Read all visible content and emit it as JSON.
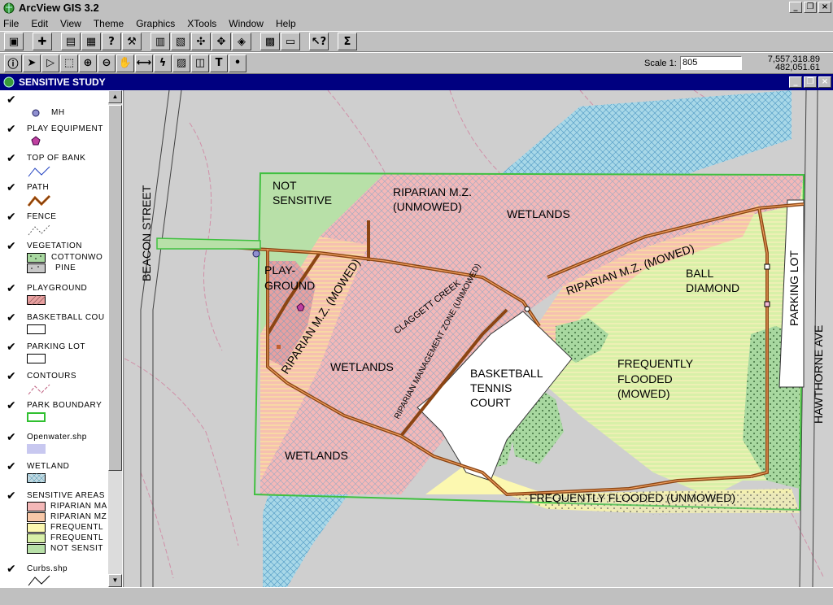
{
  "app": {
    "title": "ArcView GIS 3.2"
  },
  "menu": [
    "File",
    "Edit",
    "View",
    "Theme",
    "Graphics",
    "XTools",
    "Window",
    "Help"
  ],
  "toolbar": {
    "scale_label": "Scale 1:",
    "scale_value": "805",
    "coord_x": "7,557,318.89",
    "coord_y": "482,051.61"
  },
  "view": {
    "title": "SENSITIVE STUDY"
  },
  "legend": {
    "mh": "MH",
    "play_equipment": "PLAY EQUIPMENT",
    "top_of_bank": "TOP OF BANK",
    "path": "PATH",
    "fence": "FENCE",
    "vegetation": "VEGETATION",
    "cottonwood": "COTTONWO",
    "pine": "PINE",
    "playground": "PLAYGROUND",
    "basketball": "BASKETBALL COU",
    "parking_lot": "PARKING LOT",
    "contours": "CONTOURS",
    "park_boundary": "PARK BOUNDARY",
    "openwater": "Openwater.shp",
    "wetland": "WETLAND",
    "sensitive_areas": "SENSITIVE AREAS",
    "sa_items": [
      "RIPARIAN MA",
      "RIPARIAN MZ",
      "FREQUENTL",
      "FREQUENTL",
      "NOT SENSIT"
    ],
    "curbs": "Curbs.shp"
  },
  "colors": {
    "pink": "#f4b8b8",
    "peach": "#f8c8a8",
    "yellow": "#fcf8b0",
    "lightgreen": "#d8f0a8",
    "green": "#b8e0a8",
    "water": "#a8c8e8",
    "path": "#8b4513",
    "boundary": "#40c040",
    "titlebar": "#000080"
  },
  "map_labels": {
    "not_sensitive": [
      "NOT",
      "SENSITIVE"
    ],
    "riparian_unmowed": [
      "RIPARIAN M.Z.",
      "(UNMOWED)"
    ],
    "wetlands_top": "WETLANDS",
    "riparian_mowed_right": "RIPARIAN M.Z.  (MOWED)",
    "ball_diamond": [
      "BALL",
      "DIAMOND"
    ],
    "play_ground": [
      "PLAY-",
      "GROUND"
    ],
    "riparian_mowed_left": "RIPARIAN M.Z. (MOWED)",
    "claggett": "CLAGGETT  CREEK",
    "rmz_unmowed": "RIPARIAN MANAGEMENT ZONE (UNMOWED)",
    "wetlands_mid": "WETLANDS",
    "basketball_court": [
      "BASKETBALL",
      "TENNIS",
      "COURT"
    ],
    "frequently_flooded_mowed": [
      "FREQUENTLY",
      "FLOODED",
      "(MOWED)"
    ],
    "wetlands_bottom": "WETLANDS",
    "freq_flooded_unmowed": "FREQUENTLY FLOODED (UNMOWED)",
    "beacon": "BEACON STREET",
    "parking": "PARKING LOT",
    "hawthorne": "HAWTHORNE AVE"
  }
}
